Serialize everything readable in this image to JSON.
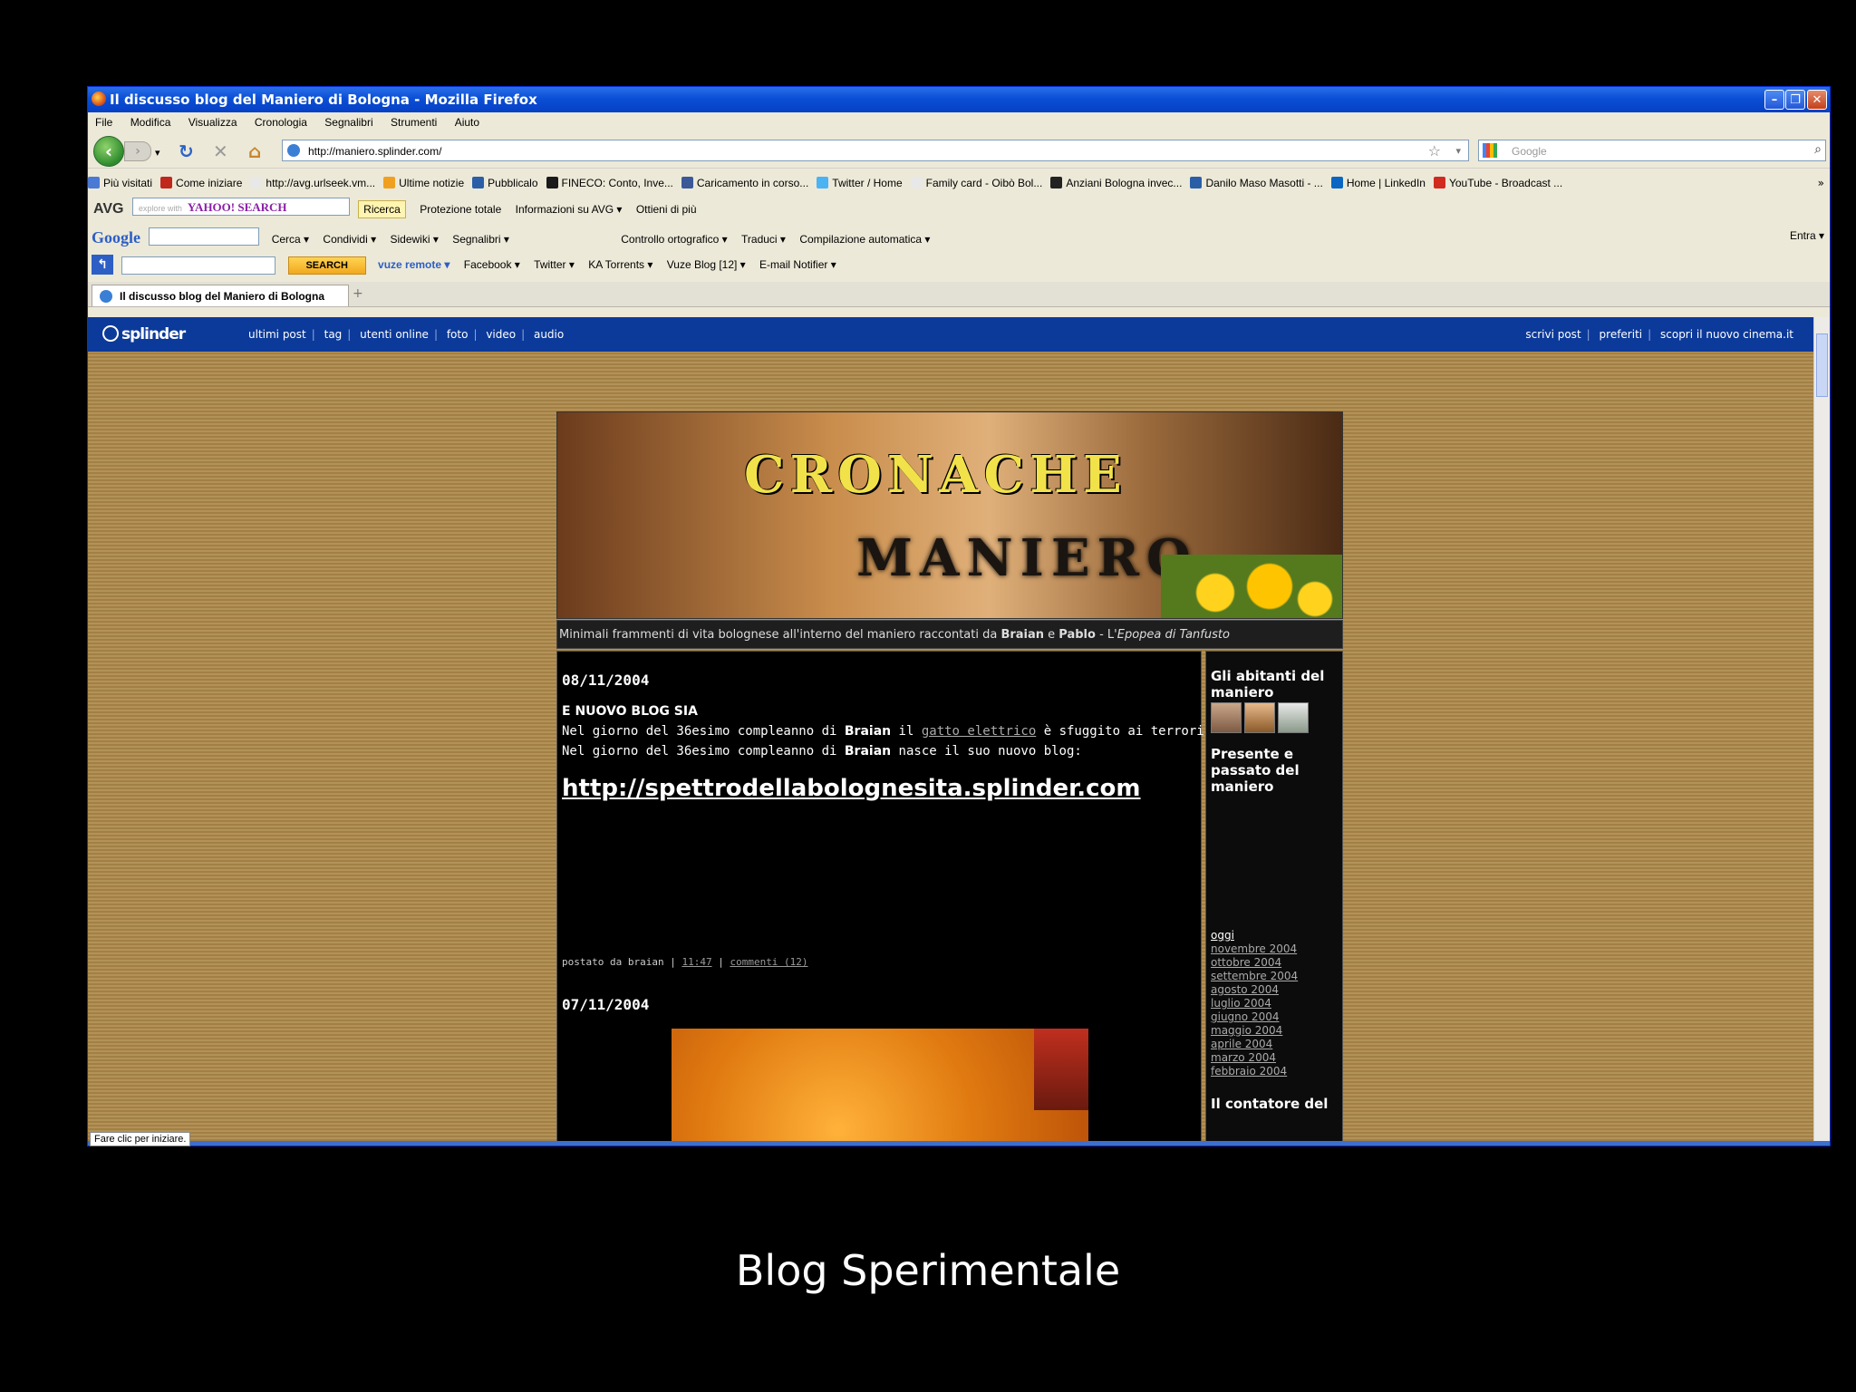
{
  "window": {
    "title": "Il discusso blog del Maniero di Bologna - Mozilla Firefox",
    "controls": [
      "minimize",
      "maximize",
      "close"
    ]
  },
  "menu": [
    "File",
    "Modifica",
    "Visualizza",
    "Cronologia",
    "Segnalibri",
    "Strumenti",
    "Aiuto"
  ],
  "nav": {
    "url": "http://maniero.splinder.com/",
    "search_placeholder": "Google"
  },
  "bookmarks": [
    {
      "label": "Più visitati",
      "color": "#4a7ad6"
    },
    {
      "label": "Come iniziare",
      "color": "#c0281e"
    },
    {
      "label": "http://avg.urlseek.vm...",
      "color": "#e8e8e8"
    },
    {
      "label": "Ultime notizie",
      "color": "#f0a020"
    },
    {
      "label": "Pubblicalo",
      "color": "#2a5fa8"
    },
    {
      "label": "FINECO: Conto, Inve...",
      "color": "#1a1a1a"
    },
    {
      "label": "Caricamento in corso...",
      "color": "#3b5998"
    },
    {
      "label": "Twitter / Home",
      "color": "#4ab3f4"
    },
    {
      "label": "Family card - Oibò Bol...",
      "color": "#e8e8e8"
    },
    {
      "label": "Anziani Bologna invec...",
      "color": "#222222"
    },
    {
      "label": "Danilo Maso Masotti - ...",
      "color": "#2a5fa8"
    },
    {
      "label": "Home | LinkedIn",
      "color": "#0a66c2"
    },
    {
      "label": "YouTube - Broadcast ...",
      "color": "#d12a1e"
    }
  ],
  "avg_toolbar": {
    "logo": "AVG",
    "yahoo_hint": "explore with",
    "yahoo_label": "YAHOO! SEARCH",
    "items": [
      "Ricerca",
      "Protezione totale",
      "Informazioni su AVG ▾",
      "Ottieni di più"
    ]
  },
  "google_toolbar": {
    "logo": "Google",
    "items": [
      "Cerca ▾",
      "Condividi ▾",
      "Sidewiki ▾",
      "Segnalibri ▾",
      "Controllo ortografico ▾",
      "Traduci ▾",
      "Compilazione automatica ▾"
    ],
    "signin": "Entra ▾"
  },
  "vuze_toolbar": {
    "search_label": "SEARCH",
    "items": [
      "vuze remote ▾",
      "Facebook ▾",
      "Twitter ▾",
      "KA Torrents ▾",
      "Vuze Blog [12] ▾",
      "E-mail Notifier ▾"
    ]
  },
  "tab": {
    "label": "Il discusso blog del Maniero di Bologna"
  },
  "splinder": {
    "logo": "splinder",
    "nav": [
      "ultimi post",
      "tag",
      "utenti online",
      "foto",
      "video",
      "audio"
    ],
    "right": [
      "scrivi post",
      "preferiti",
      "scopri il nuovo cinema.it"
    ]
  },
  "blog": {
    "banner_line1": "CRONACHE",
    "banner_line2": "MANIERO",
    "tagline_pre": "Minimali frammenti di vita bolognese all'interno del maniero raccontati da ",
    "tagline_name1": "Braian",
    "tagline_and": " e ",
    "tagline_name2": "Pablo",
    "tagline_mid": " - L'",
    "tagline_italic": "Epopea di Tanfusto",
    "post1": {
      "date": "08/11/2004",
      "title": "E NUOVO BLOG SIA",
      "l1_pre": "Nel giorno del 36esimo compleanno di ",
      "l1_name": "Braian",
      "l1_mid": " il ",
      "l1_link": "gatto elettrico",
      "l1_post": " è sfuggito ai terroristi.",
      "l2_pre": "Nel giorno del 36esimo compleanno di ",
      "l2_name": "Braian",
      "l2_post": " nasce il suo nuovo blog:",
      "big_link": "http://spettrodellabolognesita.splinder.com",
      "posted_by": "postato da braian | ",
      "time": "11:47",
      "sep": " | ",
      "comments": "commenti (12)"
    },
    "post2": {
      "date": "07/11/2004"
    },
    "sidebar": {
      "h1": "Gli abitanti del maniero",
      "h2": "Presente e passato del maniero",
      "archive": [
        "oggi",
        "novembre 2004",
        "ottobre 2004",
        "settembre 2004",
        "agosto 2004",
        "luglio 2004",
        "giugno 2004",
        "maggio 2004",
        "aprile 2004",
        "marzo 2004",
        "febbraio 2004"
      ],
      "h3": "Il contatore del"
    }
  },
  "status": {
    "tooltip": "Fare clic per iniziare."
  },
  "caption": "Blog Sperimentale"
}
